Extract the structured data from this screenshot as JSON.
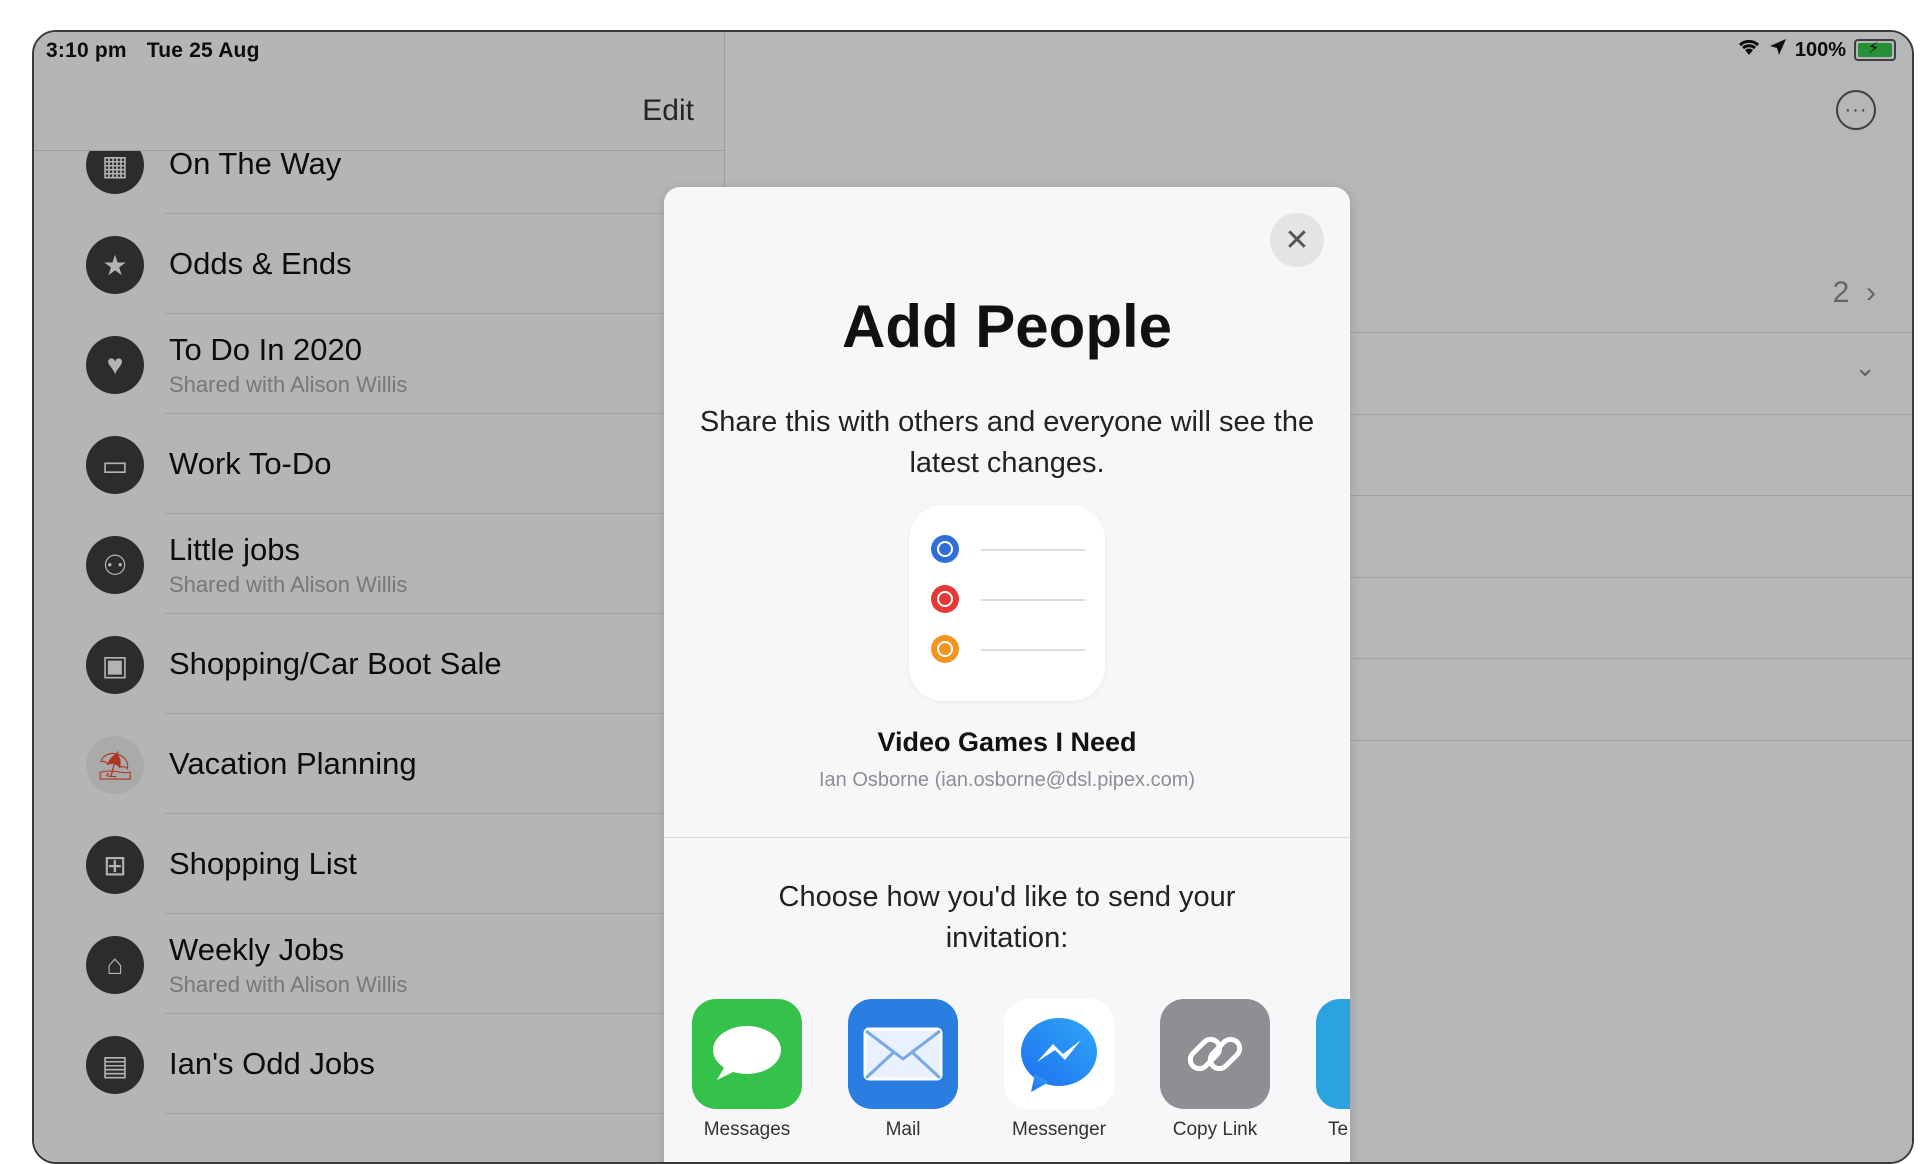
{
  "status_bar": {
    "time": "3:10 pm",
    "date": "Tue 25 Aug",
    "battery": "100%"
  },
  "sidebar": {
    "edit_label": "Edit",
    "lists": [
      {
        "title": "On The Way",
        "subtitle": "",
        "icon": "calendar-icon"
      },
      {
        "title": "Odds & Ends",
        "subtitle": "",
        "icon": "star-icon"
      },
      {
        "title": "To Do In 2020",
        "subtitle": "Shared with Alison Willis",
        "icon": "heart-icon"
      },
      {
        "title": "Work To-Do",
        "subtitle": "",
        "icon": "monitor-icon"
      },
      {
        "title": "Little jobs",
        "subtitle": "Shared with Alison Willis",
        "icon": "people-icon"
      },
      {
        "title": "Shopping/Car Boot Sale",
        "subtitle": "",
        "icon": "bag-icon"
      },
      {
        "title": "Vacation Planning",
        "subtitle": "",
        "icon": "beach-icon"
      },
      {
        "title": "Shopping List",
        "subtitle": "",
        "icon": "cart-icon"
      },
      {
        "title": "Weekly Jobs",
        "subtitle": "Shared with Alison Willis",
        "icon": "house-icon"
      },
      {
        "title": "Ian's Odd Jobs",
        "subtitle": "",
        "icon": "computer-icon"
      }
    ]
  },
  "detail": {
    "more_icon": "ellipsis-circle-icon",
    "count": "2"
  },
  "modal": {
    "title": "Add People",
    "description": "Share this with others and everyone will see the latest changes.",
    "list_name": "Video Games I Need",
    "owner": "Ian Osborne (ian.osborne@dsl.pipex.com)",
    "choose_text": "Choose how you'd like to send your invitation:",
    "dot_colors": [
      "#2f6fd6",
      "#e53935",
      "#f0961e"
    ],
    "apps": [
      {
        "label": "Messages",
        "icon": "messages-icon",
        "color": "#35c24a"
      },
      {
        "label": "Mail",
        "icon": "mail-icon",
        "color": "#2a7de1"
      },
      {
        "label": "Messenger",
        "icon": "messenger-icon",
        "color": "#ffffff"
      },
      {
        "label": "Copy Link",
        "icon": "link-icon",
        "color": "#8e8e93"
      },
      {
        "label": "Te",
        "icon": "telegram-icon",
        "color": "#2aa3e0"
      }
    ]
  }
}
